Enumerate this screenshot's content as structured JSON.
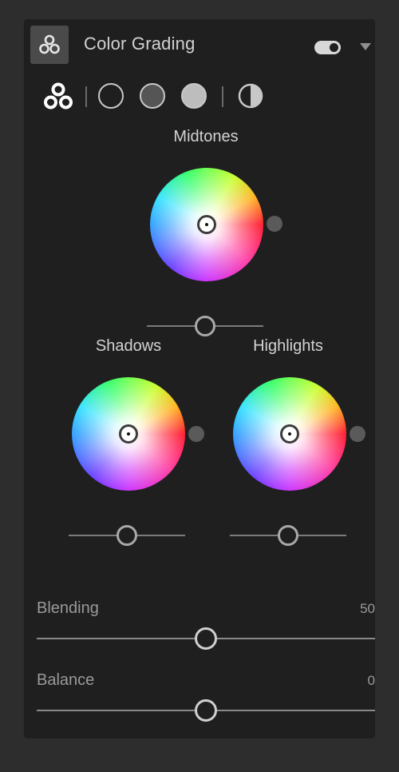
{
  "panel": {
    "title": "Color Grading",
    "icon": "color-grading-icon",
    "enabled": true
  },
  "modes": [
    {
      "name": "all-views",
      "icon": "three-circles-icon",
      "selected": true
    },
    {
      "name": "shadows",
      "icon": "empty-circle-icon"
    },
    {
      "name": "midtones",
      "icon": "gray-circle-icon"
    },
    {
      "name": "highlights",
      "icon": "light-circle-icon"
    },
    {
      "name": "global",
      "icon": "half-circle-icon"
    }
  ],
  "wheels": {
    "midtones": {
      "label": "Midtones",
      "luminance": 0.5
    },
    "shadows": {
      "label": "Shadows",
      "luminance": 0.5
    },
    "highlights": {
      "label": "Highlights",
      "luminance": 0.5
    }
  },
  "sliders": {
    "blending": {
      "label": "Blending",
      "value": "50",
      "fraction": 0.5
    },
    "balance": {
      "label": "Balance",
      "value": "0",
      "fraction": 0.5
    }
  },
  "colors": {
    "panel_bg": "#1f1f1f",
    "page_bg": "#2d2d2d",
    "text": "#d2d2d2",
    "muted_text": "#9a9a9a"
  }
}
